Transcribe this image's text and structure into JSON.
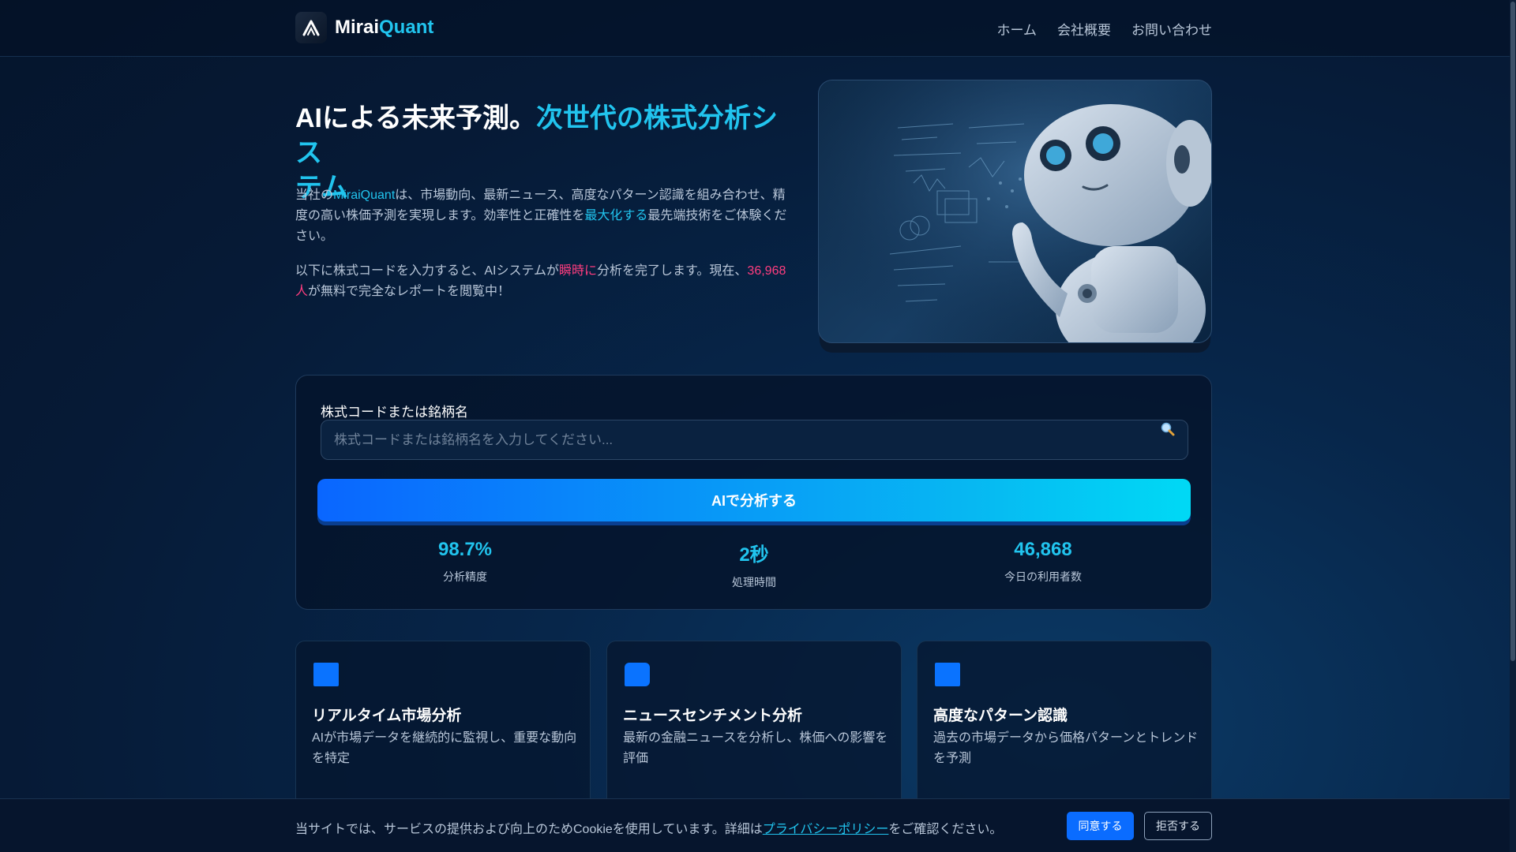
{
  "header": {
    "brand_main": "Mirai",
    "brand_accent": "Quant",
    "nav": [
      "ホーム",
      "会社概要",
      "お問い合わせ"
    ]
  },
  "hero": {
    "title_part1": "AIによる未来予測。",
    "title_part2": "次世代の株式分析シス",
    "title_part3": "テム",
    "p1": {
      "before": "当社の",
      "brand": "MiraiQuant",
      "middle": "は、市場動向、最新ニュース、高度なパターン認識を組み合わせ、精度の高い株価予測を実現します。効率性と正確性を",
      "highlight": "最大化する",
      "after": "最先端技術をご体験ください。"
    },
    "p2": {
      "before": "以下に株式コードを入力すると、AIシステムが",
      "highlight": "瞬時に",
      "middle": "分析を完了します。現在、",
      "count": "36,968人",
      "after": "が無料で完全なレポートを閲覧中！"
    }
  },
  "search": {
    "label": "株式コードまたは銘柄名",
    "placeholder": "株式コードまたは銘柄名を入力してください...",
    "value": "",
    "icon": "search-icon",
    "button_label": "AIで分析する"
  },
  "stats": [
    {
      "value": "98.7%",
      "label": "分析精度"
    },
    {
      "value": "2秒",
      "label": "処理時間"
    },
    {
      "value": "46,868",
      "label": "今日の利用者数"
    }
  ],
  "features": [
    {
      "title": "リアルタイム市場分析",
      "desc": "AIが市場データを継続的に監視し、重要な動向を特定",
      "icon": "chart-icon"
    },
    {
      "title": "ニュースセンチメント分析",
      "desc": "最新の金融ニュースを分析し、株価への影響を評価",
      "icon": "chat-icon"
    },
    {
      "title": "高度なパターン認識",
      "desc": "過去の市場データから価格パターンとトレンドを予測",
      "icon": "pattern-icon"
    }
  ],
  "cookie": {
    "text_before": "当サイトでは、サービスの提供および向上のためCookieを使用しています。詳細は",
    "link": "プライバシーポリシー",
    "text_after": "をご確認ください。",
    "agree": "同意する",
    "reject": "拒否する"
  },
  "colors": {
    "accent": "#21c4ee",
    "highlight_pink": "#ff3d7f",
    "button_primary": "#0a6cff",
    "background": "#061a36"
  }
}
